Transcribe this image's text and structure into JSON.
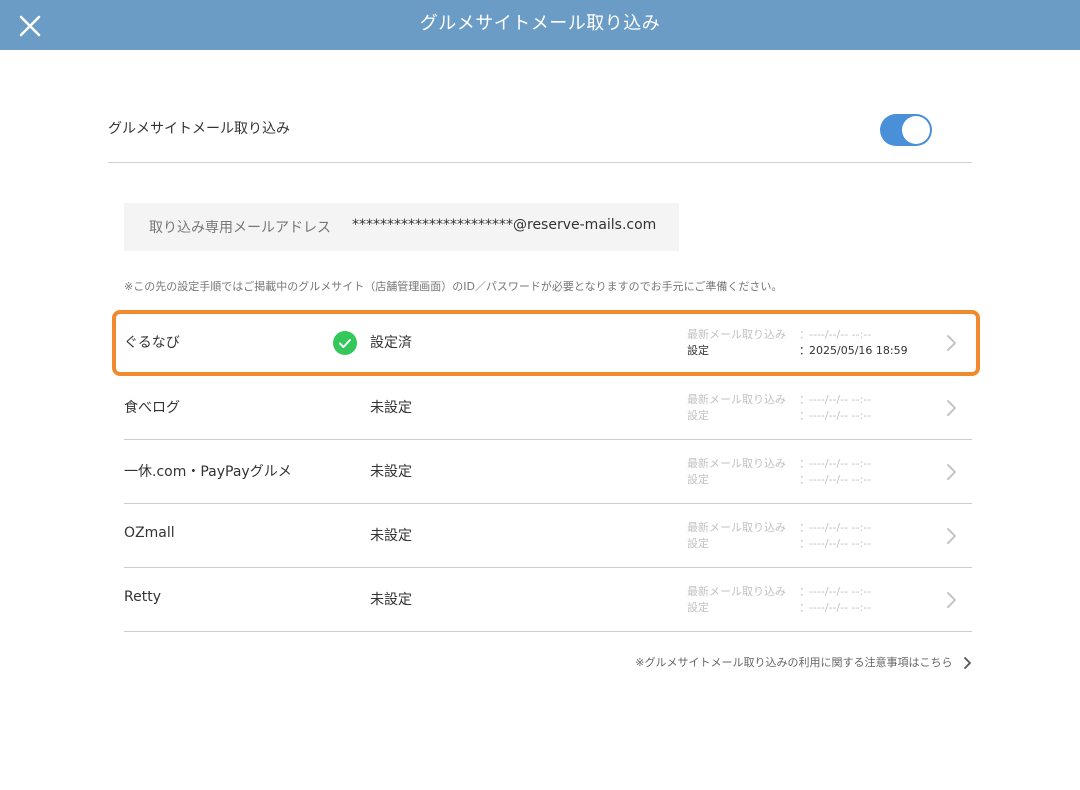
{
  "header": {
    "title": "グルメサイトメール取り込み",
    "close_icon": "close-icon",
    "background": "#6a9cc6"
  },
  "toggle_setting": {
    "label": "グルメサイトメール取り込み",
    "enabled": true,
    "accent": "#4a90d9"
  },
  "address": {
    "label": "取り込み専用メールアドレス",
    "value": "***********************@reserve-mails.com"
  },
  "notice": "※この先の設定手順ではご掲載中のグルメサイト（店舗管理画面）のID／パスワードが必要となりますのでお手元にご準備ください。",
  "sites": [
    {
      "name": "ぐるなび",
      "status": "設定済",
      "configured": true,
      "last_import_label": "最新メール取り込み",
      "last_import_value": "----/--/-- --:--",
      "setting_label": "設定",
      "setting_value": "2025/05/16 18:59",
      "colon": "："
    },
    {
      "name": "食べログ",
      "status": "未設定",
      "configured": false,
      "last_import_label": "最新メール取り込み",
      "last_import_value": "----/--/-- --:--",
      "setting_label": "設定",
      "setting_value": "----/--/-- --:--",
      "colon": "："
    },
    {
      "name": "一休.com・PayPayグルメ",
      "status": "未設定",
      "configured": false,
      "last_import_label": "最新メール取り込み",
      "last_import_value": "----/--/-- --:--",
      "setting_label": "設定",
      "setting_value": "----/--/-- --:--",
      "colon": "："
    },
    {
      "name": "OZmall",
      "status": "未設定",
      "configured": false,
      "last_import_label": "最新メール取り込み",
      "last_import_value": "----/--/-- --:--",
      "setting_label": "設定",
      "setting_value": "----/--/-- --:--",
      "colon": "："
    },
    {
      "name": "Retty",
      "status": "未設定",
      "configured": false,
      "last_import_label": "最新メール取り込み",
      "last_import_value": "----/--/-- --:--",
      "setting_label": "設定",
      "setting_value": "----/--/-- --:--",
      "colon": "："
    }
  ],
  "highlight_color": "#f08a2c",
  "check_color": "#34c759",
  "footer_link": "※グルメサイトメール取り込みの利用に関する注意事項はこちら"
}
